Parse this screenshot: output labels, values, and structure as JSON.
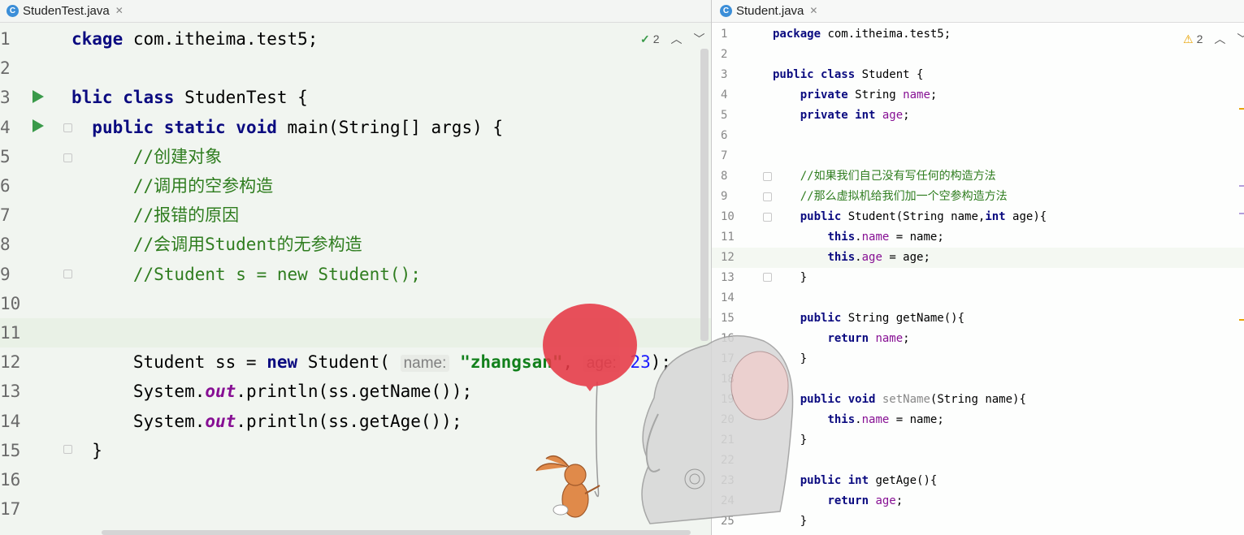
{
  "left_editor": {
    "tab": {
      "icon": "C",
      "label": "StudenTest.java"
    },
    "inspection": {
      "count": "2"
    },
    "lines": [
      {
        "num": "1",
        "html": "<span class=\"kw\">ckage</span> com.itheima.test5;"
      },
      {
        "num": "2",
        "html": ""
      },
      {
        "num": "3",
        "html": "<span class=\"kw\">blic class</span> StudenTest {"
      },
      {
        "num": "4",
        "html": "  <span class=\"kw\">public static void</span> main(String[] args) {"
      },
      {
        "num": "5",
        "html": "      <span class=\"cm\">//创建对象</span>"
      },
      {
        "num": "6",
        "html": "      <span class=\"cm\">//调用的空参构造</span>"
      },
      {
        "num": "7",
        "html": "      <span class=\"cm\">//报错的原因</span>"
      },
      {
        "num": "8",
        "html": "      <span class=\"cm\">//会调用Student的无参构造</span>"
      },
      {
        "num": "9",
        "html": "      <span class=\"cm\">//Student s = new Student();</span>"
      },
      {
        "num": "10",
        "html": ""
      },
      {
        "num": "11",
        "html": ""
      },
      {
        "num": "12",
        "html": "      Student ss = <span class=\"kw\">new</span> Student( <span class=\"hint\">name:</span> <span class=\"str\">\"zhangsan\"</span>, <span class=\"hint\">age:</span> <span class=\"num\">23</span>);"
      },
      {
        "num": "13",
        "html": "      System.<span class=\"st\">out</span>.println(ss.getName());"
      },
      {
        "num": "14",
        "html": "      System.<span class=\"st\">out</span>.println(ss.getAge());"
      },
      {
        "num": "15",
        "html": "  }"
      },
      {
        "num": "16",
        "html": ""
      },
      {
        "num": "17",
        "html": ""
      }
    ]
  },
  "right_editor": {
    "tab": {
      "icon": "C",
      "label": "Student.java"
    },
    "inspection": {
      "count": "2"
    },
    "lines": [
      {
        "num": "1",
        "html": "<span class=\"kw\">package</span> com.itheima.test5;"
      },
      {
        "num": "2",
        "html": ""
      },
      {
        "num": "3",
        "html": "<span class=\"kw\">public class</span> Student {"
      },
      {
        "num": "4",
        "html": "    <span class=\"kw\">private</span> String <span class=\"fld\">name</span>;"
      },
      {
        "num": "5",
        "html": "    <span class=\"kw\">private int</span> <span class=\"fld\">age</span>;"
      },
      {
        "num": "6",
        "html": ""
      },
      {
        "num": "7",
        "html": ""
      },
      {
        "num": "8",
        "html": "    <span class=\"cm\">//如果我们自己没有写任何的构造方法</span>"
      },
      {
        "num": "9",
        "html": "    <span class=\"cm\">//那么虚拟机给我们加一个空参构造方法</span>"
      },
      {
        "num": "10",
        "html": "    <span class=\"kw\">public</span> Student(String name,<span class=\"kw\">int</span> age){"
      },
      {
        "num": "11",
        "html": "        <span class=\"kw\">this</span>.<span class=\"fld\">name</span> = name;"
      },
      {
        "num": "12",
        "html": "        <span class=\"kw\">this</span>.<span class=\"fld\">age</span> = age;"
      },
      {
        "num": "13",
        "html": "    }"
      },
      {
        "num": "14",
        "html": ""
      },
      {
        "num": "15",
        "html": "    <span class=\"kw\">public</span> String getName(){"
      },
      {
        "num": "16",
        "html": "        <span class=\"kw\">return</span> <span class=\"fld\">name</span>;"
      },
      {
        "num": "17",
        "html": "    }"
      },
      {
        "num": "18",
        "html": ""
      },
      {
        "num": "19",
        "html": "    <span class=\"kw\">public void</span> <span class=\"dim\">setName</span>(String name){"
      },
      {
        "num": "20",
        "html": "        <span class=\"kw\">this</span>.<span class=\"fld\">name</span> = name;"
      },
      {
        "num": "21",
        "html": "    }"
      },
      {
        "num": "22",
        "html": ""
      },
      {
        "num": "23",
        "html": "    <span class=\"kw\">public int</span> getAge(){"
      },
      {
        "num": "24",
        "html": "        <span class=\"kw\">return</span> <span class=\"fld\">age</span>;"
      },
      {
        "num": "25",
        "html": "    }"
      }
    ]
  },
  "colors": {
    "run": "#3a9a4a",
    "balloon": "#e63946",
    "warning": "#e8a200"
  }
}
